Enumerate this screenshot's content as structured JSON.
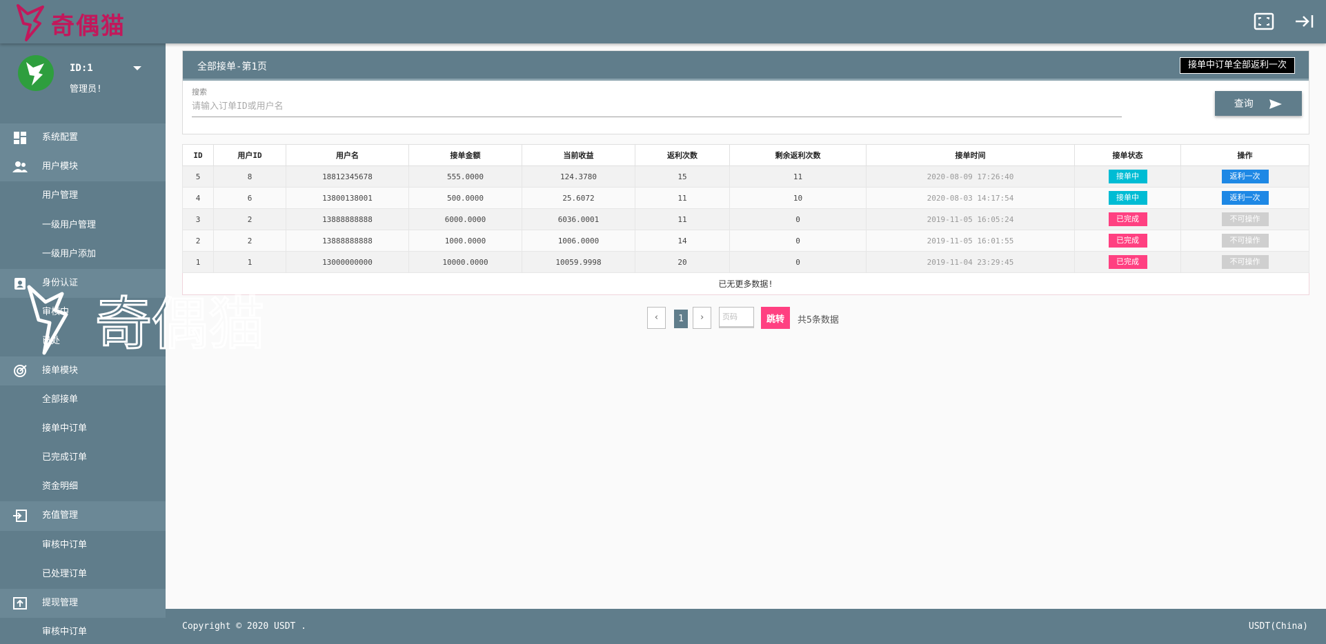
{
  "header": {
    "logo_text": "奇偶猫",
    "fullscreen_icon": "fullscreen-icon",
    "logout_icon": "logout-icon"
  },
  "user": {
    "id_label": "ID:1",
    "role": "管理员!"
  },
  "sidebar": {
    "items": [
      {
        "label": "系统配置",
        "type": "group",
        "icon": "dashboard-icon"
      },
      {
        "label": "用户模块",
        "type": "group",
        "icon": "people-icon"
      },
      {
        "label": "用户管理",
        "type": "sub"
      },
      {
        "label": "一级用户管理",
        "type": "sub"
      },
      {
        "label": "一级用户添加",
        "type": "sub"
      },
      {
        "label": "身份认证",
        "type": "group",
        "icon": "id-badge-icon"
      },
      {
        "label": "审核中",
        "type": "sub"
      },
      {
        "label": "已处",
        "type": "sub"
      },
      {
        "label": "接单模块",
        "type": "group",
        "icon": "target-icon"
      },
      {
        "label": "全部接单",
        "type": "sub"
      },
      {
        "label": "接单中订单",
        "type": "sub"
      },
      {
        "label": "已完成订单",
        "type": "sub"
      },
      {
        "label": "资金明细",
        "type": "sub"
      },
      {
        "label": "充值管理",
        "type": "group",
        "icon": "login-icon"
      },
      {
        "label": "审核中订单",
        "type": "sub"
      },
      {
        "label": "已处理订单",
        "type": "sub"
      },
      {
        "label": "提现管理",
        "type": "group",
        "icon": "upload-icon"
      },
      {
        "label": "审核中订单",
        "type": "sub"
      }
    ]
  },
  "watermark": {
    "text": "奇偶猫"
  },
  "panel": {
    "title": "全部接单-第1页",
    "rebate_all_label": "接单中订单全部返利一次",
    "search_label": "搜索",
    "search_placeholder": "请输入订单ID或用户名",
    "search_value": "",
    "query_label": "查询"
  },
  "table": {
    "columns": [
      "ID",
      "用户ID",
      "用户名",
      "接单金额",
      "当前收益",
      "返利次数",
      "剩余返利次数",
      "接单时间",
      "接单状态",
      "操作"
    ],
    "rows": [
      {
        "id": "5",
        "user_id": "8",
        "username": "18812345678",
        "amount": "555.0000",
        "income": "124.3780",
        "rebates": "15",
        "remaining": "11",
        "time": "2020-08-09 17:26:40",
        "status": "接单中",
        "status_kind": "running",
        "action": "返利一次",
        "action_enabled": true
      },
      {
        "id": "4",
        "user_id": "6",
        "username": "13800138001",
        "amount": "500.0000",
        "income": "25.6072",
        "rebates": "11",
        "remaining": "10",
        "time": "2020-08-03 14:17:54",
        "status": "接单中",
        "status_kind": "running",
        "action": "返利一次",
        "action_enabled": true
      },
      {
        "id": "3",
        "user_id": "2",
        "username": "13888888888",
        "amount": "6000.0000",
        "income": "6036.0001",
        "rebates": "11",
        "remaining": "0",
        "time": "2019-11-05 16:05:24",
        "status": "已完成",
        "status_kind": "done",
        "action": "不可操作",
        "action_enabled": false
      },
      {
        "id": "2",
        "user_id": "2",
        "username": "13888888888",
        "amount": "1000.0000",
        "income": "1006.0000",
        "rebates": "14",
        "remaining": "0",
        "time": "2019-11-05 16:01:55",
        "status": "已完成",
        "status_kind": "done",
        "action": "不可操作",
        "action_enabled": false
      },
      {
        "id": "1",
        "user_id": "1",
        "username": "13000000000",
        "amount": "10000.0000",
        "income": "10059.9998",
        "rebates": "20",
        "remaining": "0",
        "time": "2019-11-04 23:29:45",
        "status": "已完成",
        "status_kind": "done",
        "action": "不可操作",
        "action_enabled": false
      }
    ],
    "no_more": "已无更多数据!"
  },
  "pagination": {
    "prev": "‹",
    "current": "1",
    "next": "›",
    "page_placeholder": "页码",
    "go_label": "跳转",
    "total": "共5条数据"
  },
  "footer": {
    "copyright": "Copyright © 2020 USDT .",
    "right": "USDT(China)"
  },
  "colors": {
    "primary": "#607d8b",
    "accent_pink": "#ff4081",
    "cyan": "#00bcd4",
    "blue": "#1e88e5"
  }
}
